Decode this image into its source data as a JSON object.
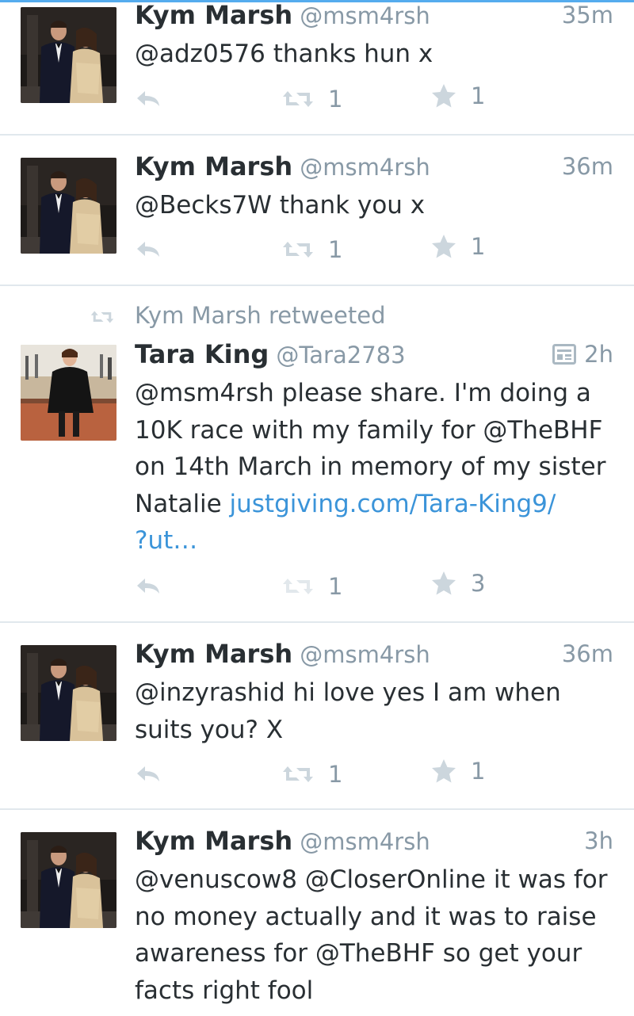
{
  "accent_color": "#55acee",
  "tweets": [
    {
      "name": "Kym Marsh",
      "handle": "@msm4rsh",
      "time": "35m",
      "text": "@adz0576 thanks hun x",
      "retweets": "1",
      "favorites": "1"
    },
    {
      "name": "Kym Marsh",
      "handle": "@msm4rsh",
      "time": "36m",
      "text": "@Becks7W thank you x",
      "retweets": "1",
      "favorites": "1"
    },
    {
      "retweeted_by": "Kym Marsh retweeted",
      "name": "Tara King",
      "handle": "@Tara2783",
      "time": "2h",
      "text_lines": [
        "@msm4rsh please share. I'm doing a",
        "10K race with my family for @TheBHF",
        "on 14th March in memory of my sister",
        "Natalie "
      ],
      "link": "justgiving.com/Tara-King9/",
      "link_cont": "?ut…",
      "retweets": "1",
      "favorites": "3"
    },
    {
      "name": "Kym Marsh",
      "handle": "@msm4rsh",
      "time": "36m",
      "text_lines": [
        "@inzyrashid hi love yes I am when",
        "suits you? X"
      ],
      "retweets": "1",
      "favorites": "1"
    },
    {
      "name": "Kym Marsh",
      "handle": "@msm4rsh",
      "time": "3h",
      "text_lines": [
        "@venuscow8 @CloserOnline it was for",
        "no money actually and it was to raise",
        "awareness for @TheBHF so get your",
        "facts right fool"
      ]
    }
  ]
}
